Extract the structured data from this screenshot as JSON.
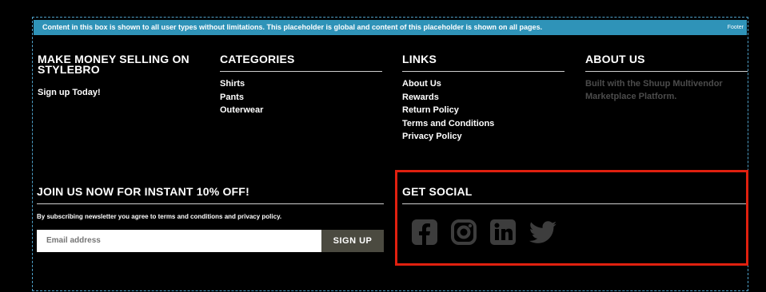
{
  "banner": {
    "text": "Content in this box is shown to all user types without limitations. This placeholder is global and content of this placeholder is shown on all pages.",
    "tag": "Footer"
  },
  "col1": {
    "title": "MAKE MONEY SELLING ON STYLEBRO",
    "link": "Sign up Today!"
  },
  "categories": {
    "title": "CATEGORIES",
    "items": [
      "Shirts",
      "Pants",
      "Outerwear"
    ]
  },
  "links": {
    "title": "LINKS",
    "items": [
      "About Us",
      "Rewards",
      "Return Policy",
      "Terms and Conditions",
      "Privacy Policy"
    ]
  },
  "about": {
    "title": "ABOUT US",
    "text": "Built with the Shuup Multivendor Marketplace Platform."
  },
  "newsletter": {
    "title": "JOIN US NOW FOR INSTANT 10% OFF!",
    "disclaimer": "By subscribing newsletter you agree to terms and conditions and privacy policy.",
    "placeholder": "Email address",
    "button": "SIGN UP"
  },
  "social": {
    "title": "GET SOCIAL",
    "icons": [
      "facebook-icon",
      "instagram-icon",
      "linkedin-icon",
      "twitter-icon"
    ],
    "icon_color": "#3d3d3d"
  },
  "colors": {
    "accent": "#2f93b8",
    "highlight": "#e0200f",
    "button_bg": "#4b4a40"
  }
}
